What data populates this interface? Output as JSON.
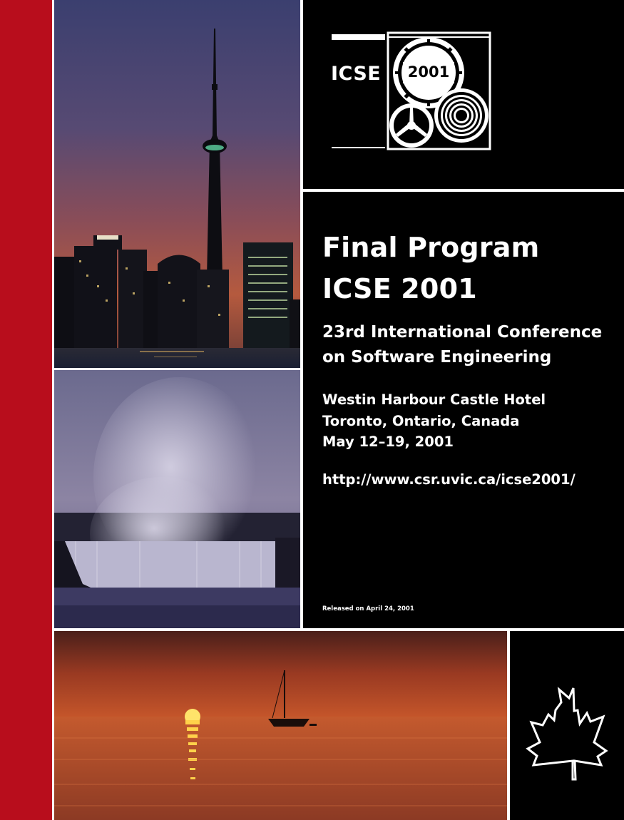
{
  "logo": {
    "acronym": "ICSE",
    "year": "2001"
  },
  "title": {
    "line1": "Final Program",
    "line2": "ICSE 2001"
  },
  "subtitle": {
    "line1": "23rd International Conference",
    "line2": "on Software Engineering"
  },
  "venue": {
    "hotel": "Westin Harbour Castle Hotel",
    "city": "Toronto, Ontario, Canada",
    "dates": "May 12–19, 2001"
  },
  "url": "http://www.csr.uvic.ca/icse2001/",
  "release_note": "Released on April 24, 2001",
  "colors": {
    "accent_red": "#b80d1c",
    "panel_black": "#000000",
    "text_white": "#ffffff"
  },
  "icons": [
    "gear-icon",
    "steering-wheel-icon",
    "concentric-rings-icon",
    "maple-leaf-icon"
  ],
  "photos": [
    "toronto-skyline-cn-tower",
    "niagara-falls-at-dusk",
    "sunset-over-lake-sailboat"
  ]
}
